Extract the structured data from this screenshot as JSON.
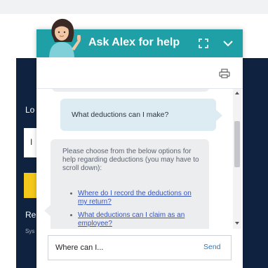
{
  "background": {
    "label_lo": "Lo",
    "label_i": "I",
    "label_re": "Re",
    "label_sys": "Sys"
  },
  "widget": {
    "title": "Ask Alex for help",
    "icons": {
      "avatar": "agent-avatar-icon",
      "expand": "expand-icon",
      "collapse": "chevron-down-icon",
      "print": "printer-icon"
    },
    "colors": {
      "header": "#1ea0a6",
      "user_bubble": "#dcecf2",
      "bot_bubble": "#ecedef",
      "link": "#3454c4",
      "send": "#2a7abf"
    }
  },
  "conversation": {
    "user_message": "What deductions can I make?",
    "bot_message": "Please choose from the below options for help regarding deductions (you may have to scroll down):",
    "bot_links": [
      "Where do I record the deductions on my return?",
      "What deductions can I claim as an employee?"
    ]
  },
  "composer": {
    "input_value": "Where can I...",
    "send_label": "Send"
  }
}
